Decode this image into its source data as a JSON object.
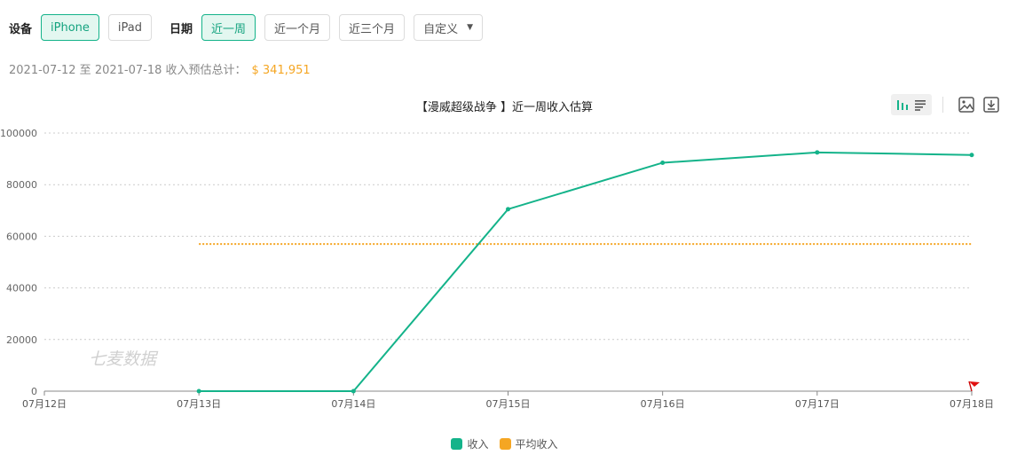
{
  "filters": {
    "device_label": "设备",
    "device_options": [
      {
        "label": "iPhone",
        "active": true
      },
      {
        "label": "iPad",
        "active": false
      }
    ],
    "date_label": "日期",
    "date_options": [
      {
        "label": "近一周",
        "active": true
      },
      {
        "label": "近一个月",
        "active": false
      },
      {
        "label": "近三个月",
        "active": false
      }
    ],
    "custom_label": "自定义"
  },
  "summary": {
    "text": "2021-07-12 至 2021-07-18 收入预估总计：",
    "total": "$ 341,951"
  },
  "toolbox": {
    "icons": [
      "bar-chart-icon",
      "table-view-icon",
      "save-image-icon",
      "download-icon"
    ]
  },
  "watermark": "七麦数据",
  "colors": {
    "accent": "#14b38a",
    "income": "#14b38a",
    "average": "#f5a623"
  },
  "chart_data": {
    "type": "line",
    "title": "【漫威超级战争 】近一周收入估算",
    "categories": [
      "07月12日",
      "07月13日",
      "07月14日",
      "07月15日",
      "07月16日",
      "07月17日",
      "07月18日"
    ],
    "series": [
      {
        "name": "收入",
        "values": [
          null,
          0,
          0,
          70500,
          88500,
          92500,
          91500
        ]
      },
      {
        "name": "平均收入",
        "values": [
          null,
          57000,
          57000,
          57000,
          57000,
          57000,
          57000
        ]
      }
    ],
    "yticks": [
      "0",
      "20000",
      "40000",
      "60000",
      "80000",
      "100000"
    ],
    "ylim": [
      0,
      100000
    ],
    "grid": true,
    "legend": "bottom-center"
  }
}
